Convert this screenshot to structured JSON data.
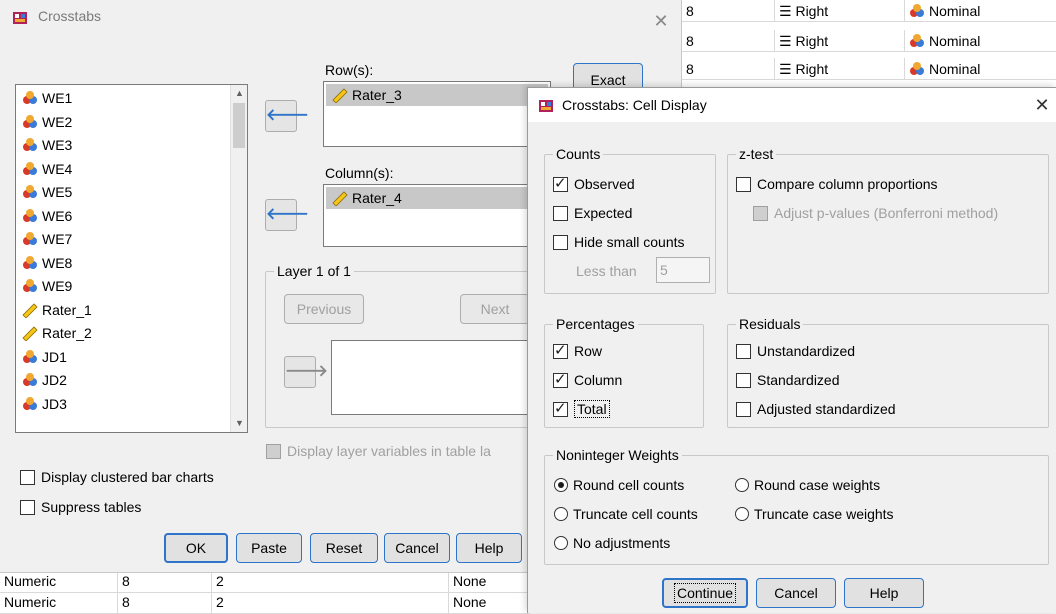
{
  "colors": {
    "accent": "#2e74c8",
    "window_bg": "#f0f0f0",
    "selection": "#c8c8c8"
  },
  "background_grid": {
    "rows": [
      {
        "width": "8",
        "align": "Right",
        "measure": "Nominal"
      },
      {
        "width": "8",
        "align": "Right",
        "measure": "Nominal"
      },
      {
        "width": "8",
        "align": "Right",
        "measure": "Nominal"
      }
    ]
  },
  "bottom_grid": {
    "rows": [
      {
        "type": "Numeric",
        "width": "8",
        "decimals": "2",
        "missing": "None"
      },
      {
        "type": "Numeric",
        "width": "8",
        "decimals": "2",
        "missing": "None"
      }
    ]
  },
  "crosstabs": {
    "title": "Crosstabs",
    "variables": [
      "WE1",
      "WE2",
      "WE3",
      "WE4",
      "WE5",
      "WE6",
      "WE7",
      "WE8",
      "WE9",
      "Rater_1",
      "Rater_2",
      "JD1",
      "JD2",
      "JD3"
    ],
    "variable_icons": [
      "nominal-icon",
      "nominal-icon",
      "nominal-icon",
      "nominal-icon",
      "nominal-icon",
      "nominal-icon",
      "nominal-icon",
      "nominal-icon",
      "nominal-icon",
      "scale-icon",
      "scale-icon",
      "nominal-icon",
      "nominal-icon",
      "nominal-icon"
    ],
    "rows_label": "Row(s):",
    "rows_value": "Rater_3",
    "columns_label": "Column(s):",
    "columns_value": "Rater_4",
    "layer_label": "Layer 1 of 1",
    "previous_label": "Previous",
    "next_label": "Next",
    "display_layer_label": "Display layer variables in table la",
    "clustered_label": "Display clustered bar charts",
    "suppress_label": "Suppress tables",
    "exact_label": "Exact",
    "buttons": {
      "ok": "OK",
      "paste": "Paste",
      "reset": "Reset",
      "cancel": "Cancel",
      "help": "Help"
    }
  },
  "cell_display": {
    "title": "Crosstabs: Cell Display",
    "counts": {
      "legend": "Counts",
      "observed": "Observed",
      "expected": "Expected",
      "hide_small": "Hide small counts",
      "less_than": "Less than",
      "less_than_value": "5"
    },
    "ztest": {
      "legend": "z-test",
      "compare": "Compare column proportions",
      "adjust": "Adjust p-values (Bonferroni method)"
    },
    "percentages": {
      "legend": "Percentages",
      "row": "Row",
      "column": "Column",
      "total": "Total"
    },
    "residuals": {
      "legend": "Residuals",
      "unstandardized": "Unstandardized",
      "standardized": "Standardized",
      "adjusted": "Adjusted standardized"
    },
    "weights": {
      "legend": "Noninteger Weights",
      "round_cell": "Round cell counts",
      "round_case": "Round case weights",
      "truncate_cell": "Truncate cell counts",
      "truncate_case": "Truncate case weights",
      "no_adjust": "No adjustments"
    },
    "buttons": {
      "continue": "Continue",
      "cancel": "Cancel",
      "help": "Help"
    }
  }
}
